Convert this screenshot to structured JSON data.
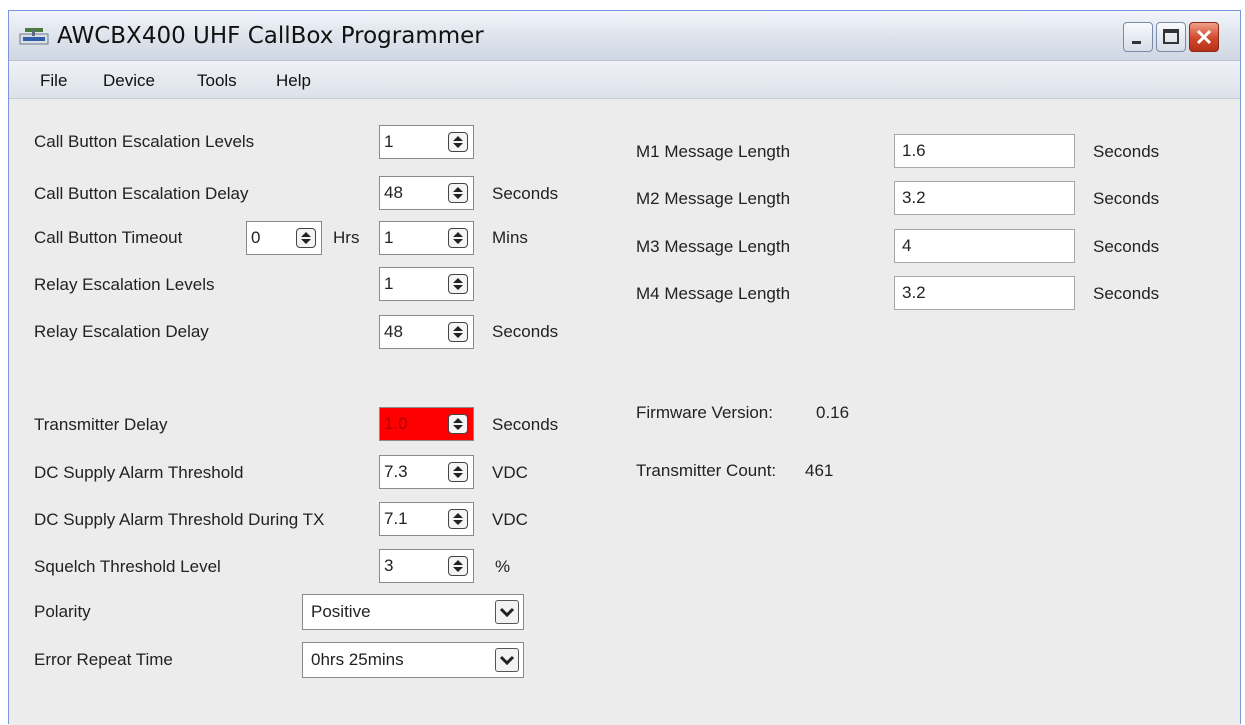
{
  "window": {
    "title": "AWCBX400 UHF CallBox Programmer",
    "icon": "callbox-app-icon",
    "controls": [
      "minimize-icon",
      "maximize-icon",
      "close-icon"
    ]
  },
  "menu": {
    "items": [
      "File",
      "Device",
      "Tools",
      "Help"
    ]
  },
  "settings": {
    "call_button_escalation_levels": {
      "label": "Call Button Escalation Levels",
      "value": "1"
    },
    "call_button_escalation_delay": {
      "label": "Call Button Escalation Delay",
      "value": "48",
      "unit": "Seconds"
    },
    "call_button_timeout": {
      "label": "Call Button Timeout",
      "hrs_value": "0",
      "hrs_unit": "Hrs",
      "mins_value": "1",
      "mins_unit": "Mins"
    },
    "relay_escalation_levels": {
      "label": "Relay Escalation Levels",
      "value": "1"
    },
    "relay_escalation_delay": {
      "label": "Relay Escalation Delay",
      "value": "48",
      "unit": "Seconds"
    },
    "transmitter_delay": {
      "label": "Transmitter Delay",
      "value": "1.0",
      "unit": "Seconds",
      "highlight_color": "#ff0000"
    },
    "dc_supply_alarm_threshold": {
      "label": "DC Supply Alarm Threshold",
      "value": "7.3",
      "unit": "VDC"
    },
    "dc_supply_alarm_threshold_tx": {
      "label": "DC Supply Alarm Threshold During TX",
      "value": "7.1",
      "unit": "VDC"
    },
    "squelch_threshold_level": {
      "label": "Squelch Threshold Level",
      "value": "3",
      "unit": "%"
    },
    "polarity": {
      "label": "Polarity",
      "selected": "Positive"
    },
    "error_repeat_time": {
      "label": "Error Repeat Time",
      "selected": "0hrs 25mins"
    }
  },
  "messages": {
    "m1": {
      "label": "M1 Message Length",
      "value": "1.6",
      "unit": "Seconds"
    },
    "m2": {
      "label": "M2 Message Length",
      "value": "3.2",
      "unit": "Seconds"
    },
    "m3": {
      "label": "M3 Message Length",
      "value": "4",
      "unit": "Seconds"
    },
    "m4": {
      "label": "M4 Message Length",
      "value": "3.2",
      "unit": "Seconds"
    }
  },
  "info": {
    "firmware_label": "Firmware Version:",
    "firmware_value": "0.16",
    "tx_count_label": "Transmitter Count:",
    "tx_count_value": "461"
  }
}
